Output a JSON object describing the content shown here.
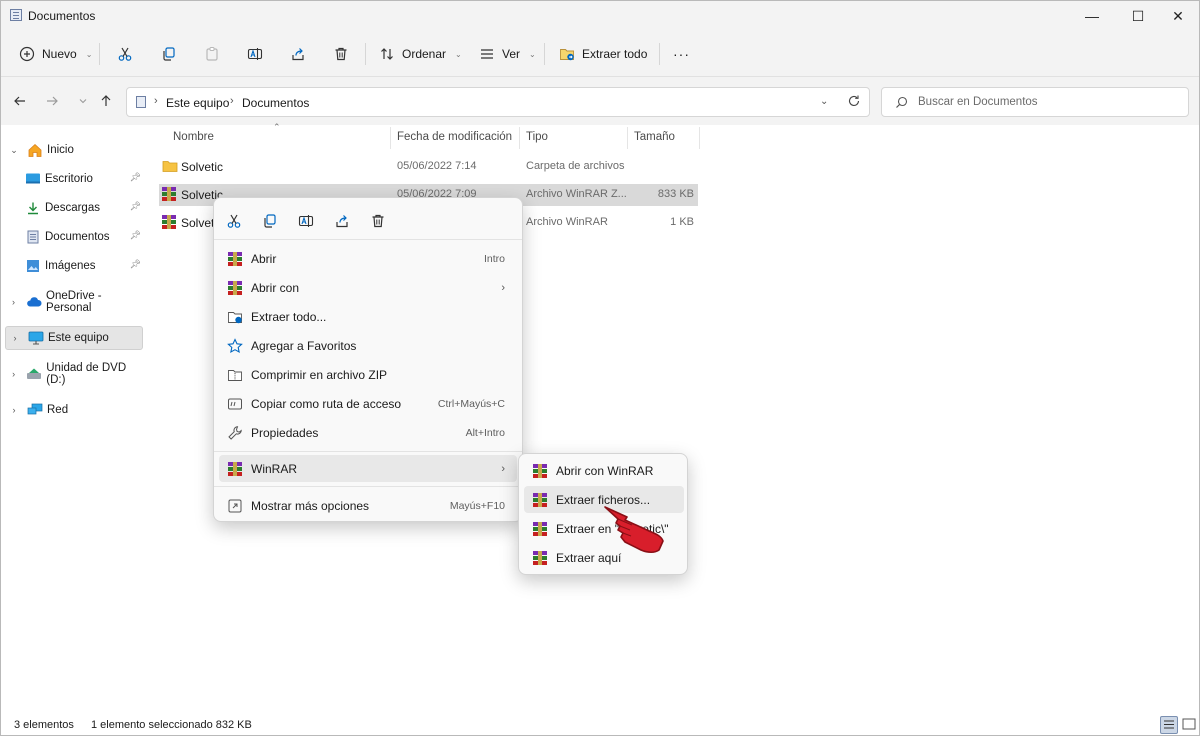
{
  "window": {
    "title": "Documentos",
    "controls": {
      "minimize": "—",
      "maximize": "☐",
      "close": "✕"
    }
  },
  "toolbar": {
    "new_label": "Nuevo",
    "sort_label": "Ordenar",
    "view_label": "Ver",
    "extract_all_label": "Extraer todo",
    "more_label": "···"
  },
  "address": {
    "crumbs": [
      "Este equipo",
      "Documentos"
    ],
    "search_placeholder": "Buscar en Documentos"
  },
  "nav": {
    "items": [
      {
        "label": "Inicio",
        "icon": "home-icon"
      },
      {
        "label": "Escritorio",
        "icon": "desktop-icon",
        "pinned": true
      },
      {
        "label": "Descargas",
        "icon": "download-icon",
        "pinned": true
      },
      {
        "label": "Documentos",
        "icon": "documents-icon",
        "pinned": true
      },
      {
        "label": "Imágenes",
        "icon": "pictures-icon",
        "pinned": true
      },
      {
        "label": "OneDrive - Personal",
        "icon": "cloud-icon"
      },
      {
        "label": "Este equipo",
        "icon": "pc-icon",
        "selected": true
      },
      {
        "label": "Unidad de DVD (D:)",
        "icon": "dvd-icon"
      },
      {
        "label": "Red",
        "icon": "network-icon"
      }
    ]
  },
  "columns": {
    "name": "Nombre",
    "modified": "Fecha de modificación",
    "type": "Tipo",
    "size": "Tamaño"
  },
  "files": [
    {
      "name": "Solvetic",
      "modified": "05/06/2022 7:14",
      "type": "Carpeta de archivos",
      "size": "",
      "icon": "folder-icon"
    },
    {
      "name": "Solvetic",
      "modified": "05/06/2022 7:09",
      "type": "Archivo WinRAR Z...",
      "size": "833 KB",
      "icon": "winrar-icon",
      "selected": true
    },
    {
      "name": "Solvetic",
      "modified": "",
      "type": "Archivo WinRAR",
      "size": "1 KB",
      "icon": "winrar-icon"
    }
  ],
  "context_menu": {
    "quick_actions": [
      "cut-icon",
      "copy-icon",
      "rename-icon",
      "share-icon",
      "delete-icon"
    ],
    "items": [
      {
        "label": "Abrir",
        "shortcut": "Intro",
        "icon": "winrar-icon"
      },
      {
        "label": "Abrir con",
        "shortcut": "",
        "icon": "open-with-icon",
        "submenu": true
      },
      {
        "label": "Extraer todo...",
        "shortcut": "",
        "icon": "extract-all-icon"
      },
      {
        "label": "Agregar a Favoritos",
        "shortcut": "",
        "icon": "star-icon"
      },
      {
        "label": "Comprimir en archivo ZIP",
        "shortcut": "",
        "icon": "zip-icon"
      },
      {
        "label": "Copiar como ruta de acceso",
        "shortcut": "Ctrl+Mayús+C",
        "icon": "copy-path-icon"
      },
      {
        "label": "Propiedades",
        "shortcut": "Alt+Intro",
        "icon": "wrench-icon"
      }
    ],
    "winrar": {
      "label": "WinRAR",
      "icon": "winrar-icon"
    },
    "more": {
      "label": "Mostrar más opciones",
      "shortcut": "Mayús+F10",
      "icon": "more-options-icon"
    }
  },
  "submenu": {
    "items": [
      {
        "label": "Abrir con WinRAR"
      },
      {
        "label": "Extraer ficheros...",
        "highlighted": true
      },
      {
        "label": "Extraer en \"Solvetic\\\""
      },
      {
        "label": "Extraer aquí"
      }
    ]
  },
  "status": {
    "count": "3 elementos",
    "selection": "1 elemento seleccionado  832 KB"
  },
  "colors": {
    "accent": "#0067c0",
    "folder": "#f6c343",
    "cursor_red": "#d81e2b"
  }
}
